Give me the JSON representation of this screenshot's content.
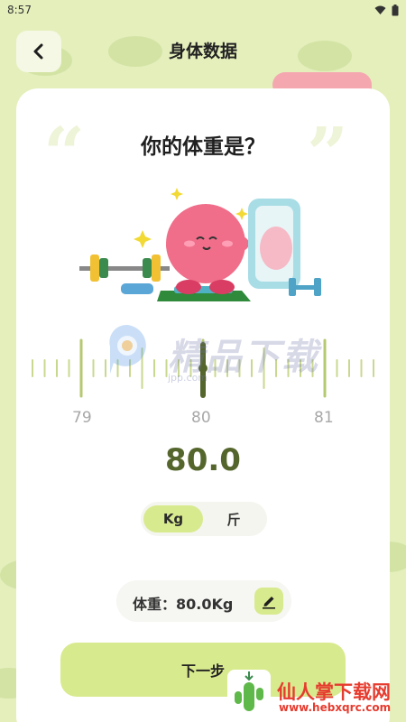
{
  "status_bar": {
    "time": "8:57"
  },
  "header": {
    "title": "身体数据"
  },
  "question": "你的体重是？",
  "ruler": {
    "labels": [
      "79",
      "80",
      "81"
    ],
    "current_value": 80.0
  },
  "weight_display": "80.0",
  "unit_toggle": {
    "options": [
      "Kg",
      "斤"
    ],
    "selected": "Kg"
  },
  "summary": {
    "text": "体重：80.0Kg"
  },
  "next_button": {
    "label": "下一步"
  },
  "watermark": {
    "text": "精品下载",
    "url": "jpp.com"
  },
  "corner_badge": {
    "text": "仙人掌下载网",
    "url": "www.hebxqrc.com"
  },
  "colors": {
    "background": "#e4efbc",
    "accent": "#d8ea8e",
    "value_text": "#55662d",
    "character": "#f06e8a"
  },
  "icons": [
    "back-arrow-icon",
    "wifi-icon",
    "battery-icon",
    "edit-pen-icon"
  ]
}
